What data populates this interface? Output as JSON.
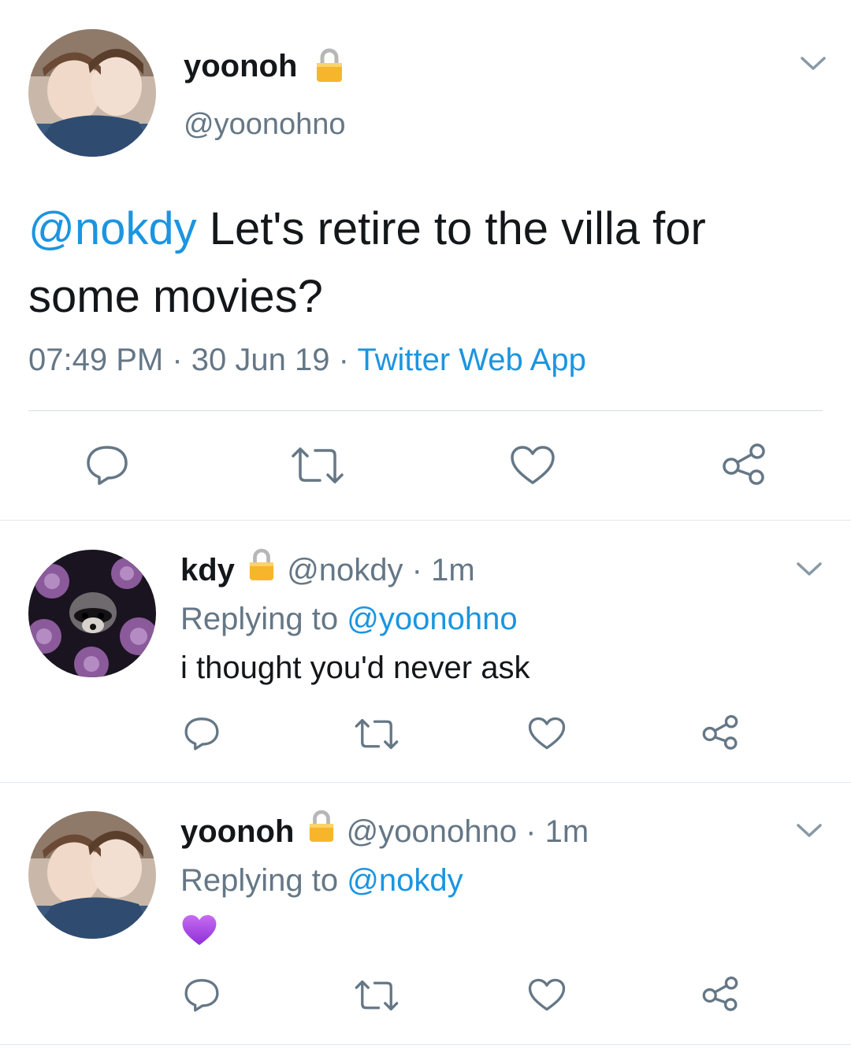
{
  "main_tweet": {
    "display_name": "yoonoh",
    "handle": "@yoonohno",
    "mention": "@nokdy",
    "text_line1": "Let's retire to the villa for",
    "text_line2": "some movies?",
    "time": "07:49 PM",
    "date": "30 Jun 19",
    "source": "Twitter Web App",
    "sep": "·"
  },
  "replies": [
    {
      "display_name": "kdy",
      "handle": "@nokdy",
      "age": "1m",
      "sep": "·",
      "replying_label": "Replying to",
      "replying_handle": "@yoonohno",
      "text": "i thought you'd never ask"
    },
    {
      "display_name": "yoonoh",
      "handle": "@yoonohno",
      "age": "1m",
      "sep": "·",
      "replying_label": "Replying to",
      "replying_handle": "@nokdy",
      "text": ""
    }
  ],
  "icons": {
    "reply": "reply-icon",
    "retweet": "retweet-icon",
    "like": "heart-icon",
    "share": "share-icon",
    "caret": "chevron-down-icon",
    "lock": "lock-icon",
    "heart_emoji": "purple-heart-emoji"
  },
  "colors": {
    "link": "#1b95e0",
    "muted": "#657786",
    "text": "#14171a",
    "divider": "#e1e8ed",
    "purple_heart": "#a64ee6"
  }
}
